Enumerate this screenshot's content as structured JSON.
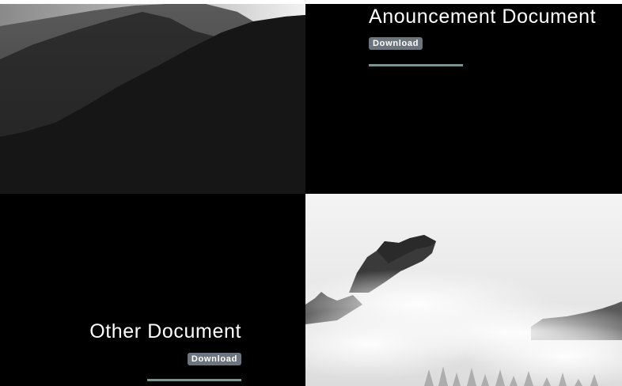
{
  "documents": [
    {
      "title": "Anouncement Document",
      "download_label": "Download"
    },
    {
      "title": "Other Document",
      "download_label": "Download"
    }
  ],
  "images": [
    {
      "icon": "dark-mountain-ridge-photo"
    },
    {
      "icon": "misty-mountain-peak-photo"
    }
  ],
  "colors": {
    "panel_background": "#000000",
    "button_background": "#6c757d",
    "accent_line": "#6b9a92",
    "title_text": "#ffffff"
  }
}
